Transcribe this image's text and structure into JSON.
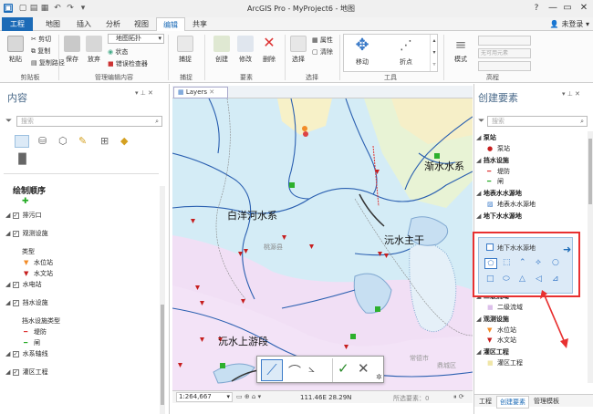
{
  "window": {
    "title": "ArcGIS Pro - MyProject6 - 地图",
    "user": "未登录",
    "help": "?",
    "minimize": "—",
    "restore": "▭",
    "close": "✕"
  },
  "tabs": [
    "工程",
    "地图",
    "插入",
    "分析",
    "视图",
    "编辑",
    "共享"
  ],
  "ribbon": {
    "clipboard": {
      "paste": "粘贴",
      "cut": "剪切",
      "copy": "复制",
      "copy_path": "复制路径",
      "group": "剪贴板"
    },
    "manage": {
      "save": "保存",
      "discard": "放弃",
      "topology": "地图拓扑",
      "status": "状态",
      "error_inspector": "错误检查器",
      "group": "管理编辑内容"
    },
    "snap": {
      "label": "捕捉",
      "group": "捕捉"
    },
    "features": {
      "create": "创建",
      "modify": "修改",
      "delete": "删除",
      "group": "要素"
    },
    "selection": {
      "select": "选择",
      "attributes": "属性",
      "clear": "清除",
      "group": "选择"
    },
    "tools": {
      "move": "移动",
      "vertices": "折点",
      "group": "工具"
    },
    "elements": {
      "mode": "模式",
      "search_placeholder": "无可用元素",
      "group": "高程"
    }
  },
  "contents": {
    "title": "内容",
    "search_placeholder": "搜索",
    "drawing_order": "绘制顺序",
    "items": [
      {
        "label": "排污口",
        "checked": true
      },
      {
        "label": "观测设施",
        "checked": true
      },
      {
        "label": "类型",
        "sub": true
      },
      {
        "label": "水位站",
        "sym": "tri-orange"
      },
      {
        "label": "水文站",
        "sym": "tri-red"
      },
      {
        "label": "水电站",
        "checked": true
      },
      {
        "label": "挡水设施",
        "checked": true
      },
      {
        "label": "挡水设施类型",
        "sub": true
      },
      {
        "label": "堤防",
        "sym": "line-red"
      },
      {
        "label": "闸",
        "sym": "line-green"
      },
      {
        "label": "水系轴线",
        "checked": true
      },
      {
        "label": "灌区工程",
        "checked": true
      }
    ]
  },
  "map": {
    "tab": "Layers",
    "scale": "1:264,667",
    "coords": "111.46E 28.29N",
    "selected_features": "所选要素：0",
    "labels": [
      "白洋河水系",
      "沅水主干",
      "沅水上游段",
      "渐水水系"
    ],
    "small_labels": [
      "桃源县",
      "常德市",
      "鼎城区"
    ]
  },
  "create_features": {
    "title": "创建要素",
    "search_placeholder": "搜索",
    "groups": [
      {
        "name": "泵站",
        "items": [
          {
            "label": "泵站",
            "sym": "pump"
          }
        ]
      },
      {
        "name": "挡水设施",
        "items": [
          {
            "label": "堤防",
            "sym": "line-red"
          },
          {
            "label": "闸",
            "sym": "line-green"
          }
        ]
      },
      {
        "name": "地表水水源地",
        "items": [
          {
            "label": "地表水水源地",
            "sym": "hatch"
          }
        ]
      },
      {
        "name": "地下水水源地",
        "items": [
          {
            "label": "地下水水源地",
            "sym": "box"
          }
        ]
      },
      {
        "name": "二级流域",
        "items": [
          {
            "label": "二级流域",
            "sym": "purple"
          }
        ]
      },
      {
        "name": "观测设施",
        "items": [
          {
            "label": "水位站",
            "sym": "tri-orange"
          },
          {
            "label": "水文站",
            "sym": "tri-red"
          }
        ]
      },
      {
        "name": "灌区工程",
        "items": [
          {
            "label": "灌区工程",
            "sym": "yellow"
          }
        ]
      }
    ],
    "bottom_tabs": [
      "工程",
      "创建要素",
      "管理模板"
    ]
  }
}
